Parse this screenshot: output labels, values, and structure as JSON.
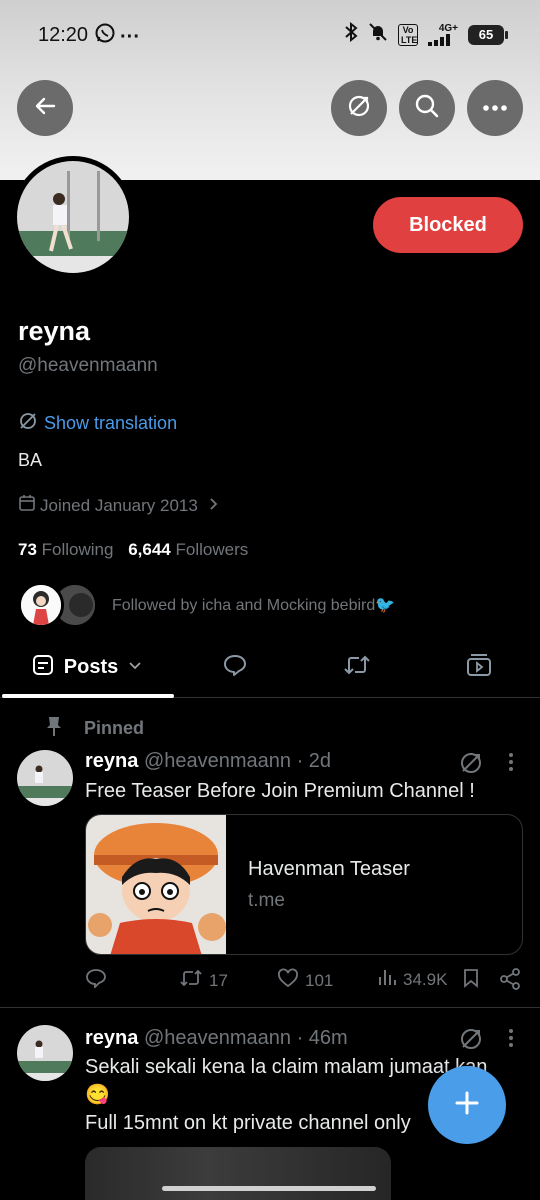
{
  "status": {
    "time": "12:20",
    "battery": "65",
    "network": "4G+",
    "volte": "Vo LTE"
  },
  "profile": {
    "blocked_label": "Blocked",
    "name": "reyna",
    "handle": "@heavenmaann",
    "show_translation": "Show translation",
    "bio": "BA",
    "joined": "Joined January 2013",
    "following_count": "73",
    "following_label": "Following",
    "followers_count": "6,644",
    "followers_label": "Followers",
    "followed_by": "Followed by icha and Mocking bebird🐦"
  },
  "tabs": {
    "posts_label": "Posts"
  },
  "pinned_label": "Pinned",
  "posts": [
    {
      "name": "reyna",
      "handle_time": "@heavenmaann · 2d",
      "text": "Free Teaser Before Join Premium Channel !",
      "card_title": "Havenman Teaser",
      "card_domain": "t.me",
      "reposts": "17",
      "likes": "101",
      "views": "34.9K"
    },
    {
      "name": "reyna",
      "handle_time": "@heavenmaann · 46m",
      "text_line1": "Sekali sekali kena la claim malam jumaat kan",
      "text_line2": "😋",
      "text_line3": "Full 15mnt on kt private channel only"
    }
  ],
  "colors": {
    "accent": "#4b9ae8",
    "blocked": "#e0403f",
    "fab": "#4a9ee9"
  }
}
